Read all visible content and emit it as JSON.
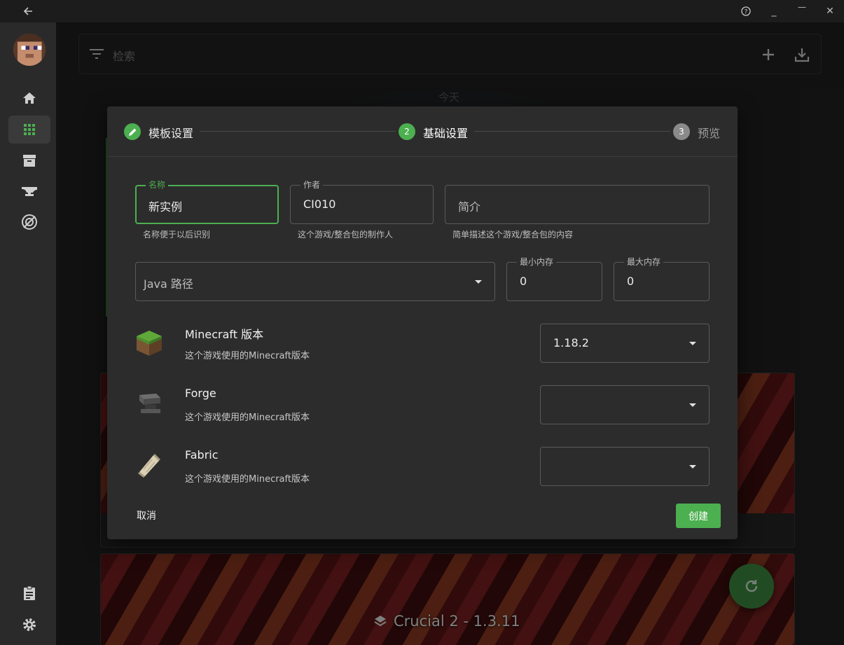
{
  "window": {
    "back_icon": "arrow-left-icon",
    "help_icon": "help-icon",
    "minimize_glyph": "_",
    "maximize_glyph": "—",
    "close_glyph": "✕"
  },
  "search": {
    "placeholder": "检索"
  },
  "timeline": {
    "today_label": "今天"
  },
  "instance_card": {
    "title": "Crucial 2 - 1.3.11"
  },
  "dialog": {
    "steps": [
      {
        "label": "模板设置",
        "state": "done",
        "number": ""
      },
      {
        "label": "基础设置",
        "state": "active",
        "number": "2"
      },
      {
        "label": "预览",
        "state": "pending",
        "number": "3"
      }
    ],
    "name": {
      "label": "名称",
      "value": "新实例",
      "hint": "名称便于以后识别"
    },
    "author": {
      "label": "作者",
      "value": "CI010",
      "hint": "这个游戏/整合包的制作人"
    },
    "description": {
      "placeholder": "简介",
      "hint": "简单描述这个游戏/整合包的内容"
    },
    "java_path": {
      "placeholder": "Java 路径"
    },
    "min_memory": {
      "label": "最小内存",
      "value": "0"
    },
    "max_memory": {
      "label": "最大内存",
      "value": "0"
    },
    "versions": [
      {
        "title": "Minecraft 版本",
        "subtitle": "这个游戏使用的Minecraft版本",
        "value": "1.18.2",
        "icon": "grass-block-icon"
      },
      {
        "title": "Forge",
        "subtitle": "这个游戏使用的Minecraft版本",
        "value": "",
        "icon": "anvil-icon"
      },
      {
        "title": "Fabric",
        "subtitle": "这个游戏使用的Minecraft版本",
        "value": "",
        "icon": "fabric-scroll-icon"
      }
    ],
    "cancel_label": "取消",
    "create_label": "创建"
  },
  "colors": {
    "accent": "#4caf50",
    "fab": "#3d8a40",
    "dialog_bg": "#2c2c2c"
  }
}
